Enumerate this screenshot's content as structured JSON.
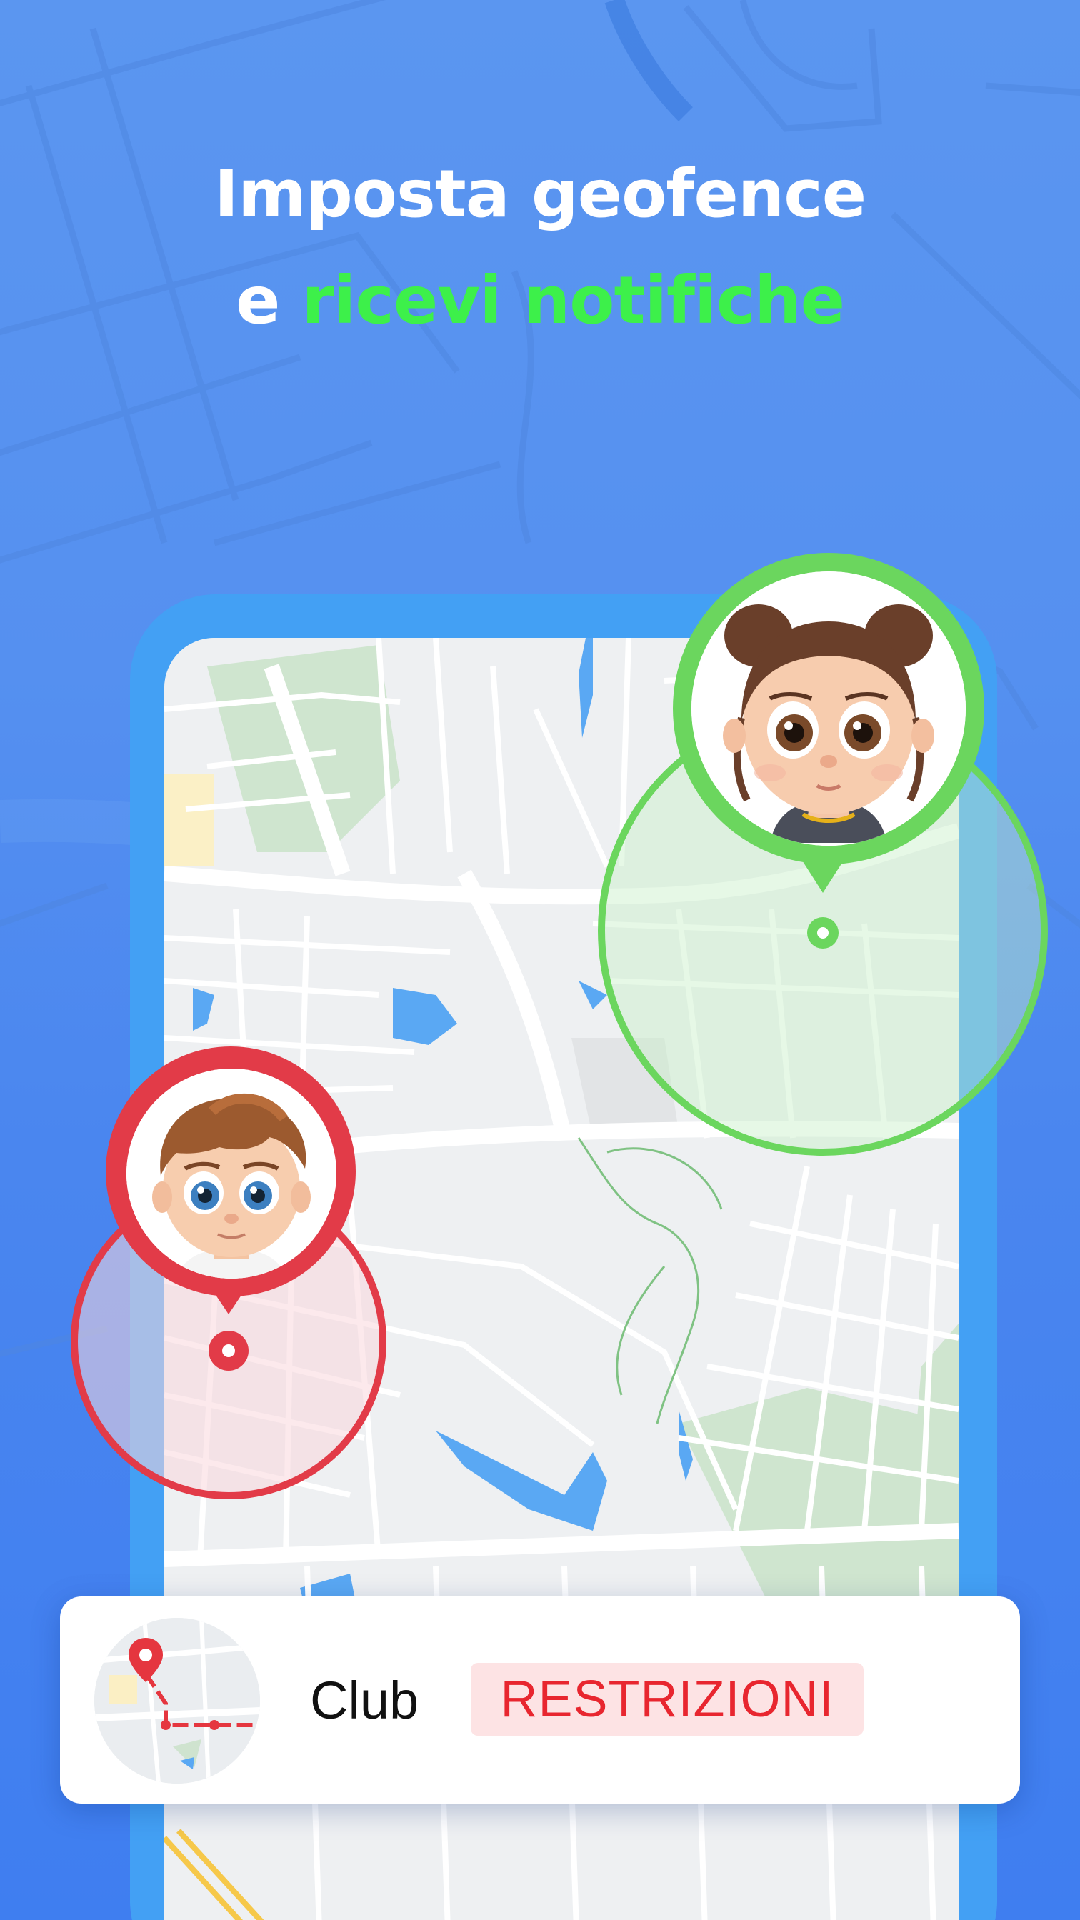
{
  "headline": {
    "line1": "Imposta geofence",
    "line2_prefix": "e ",
    "line2_accent": "ricevi notifiche"
  },
  "colors": {
    "background": "#5590f0",
    "accent_green": "#3df04a",
    "phone_frame": "#43a0f4",
    "geofence_safe": "#6bd65e",
    "geofence_alert": "#e23b48",
    "badge_text": "#e8262f",
    "badge_bg": "#fde3e4"
  },
  "map": {
    "geofences": [
      {
        "name": "girl",
        "status": "safe",
        "icon": "girl-avatar-icon"
      },
      {
        "name": "boy",
        "status": "alert",
        "icon": "boy-avatar-icon"
      }
    ]
  },
  "card": {
    "thumbnail_icon": "route-map-icon",
    "place_name": "Club",
    "status_label": "RESTRIZIONI"
  }
}
